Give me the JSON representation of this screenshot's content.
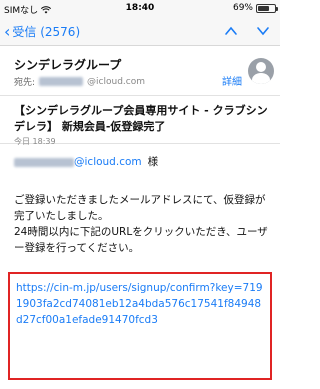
{
  "status_bar": {
    "carrier": "SIMなし",
    "time": "18:40",
    "battery": "69%",
    "battery_level": 0.69
  },
  "nav": {
    "back_label": "受信 (2576)",
    "up_icon": "chevron-up-icon",
    "down_icon": "chevron-down-icon"
  },
  "header": {
    "sender": "シンデレラグループ",
    "to_label": "宛先:",
    "to_domain": "@icloud.com",
    "details_label": "詳細"
  },
  "message": {
    "subject": "【シンデレラグループ会員専用サイト - クラブシンデレラ】 新規会員-仮登録完了",
    "date": "今日 18:39",
    "recipient_domain": "@icloud.com",
    "honorific": "様",
    "paragraph_1": "ご登録いただきましたメールアドレスにて、仮登録が完了いたしました。",
    "paragraph_2": "24時間以内に下記のURLをクリックいただき、ユーザー登録を行ってください。",
    "link": "https://cin-m.jp/users/signup/confirm?key=7191903fa2cd74081eb12a4bda576c17541f84948d27cf00a1efade91470fcd3"
  },
  "colors": {
    "accent": "#1a7cf6",
    "highlight_border": "#e02424"
  }
}
